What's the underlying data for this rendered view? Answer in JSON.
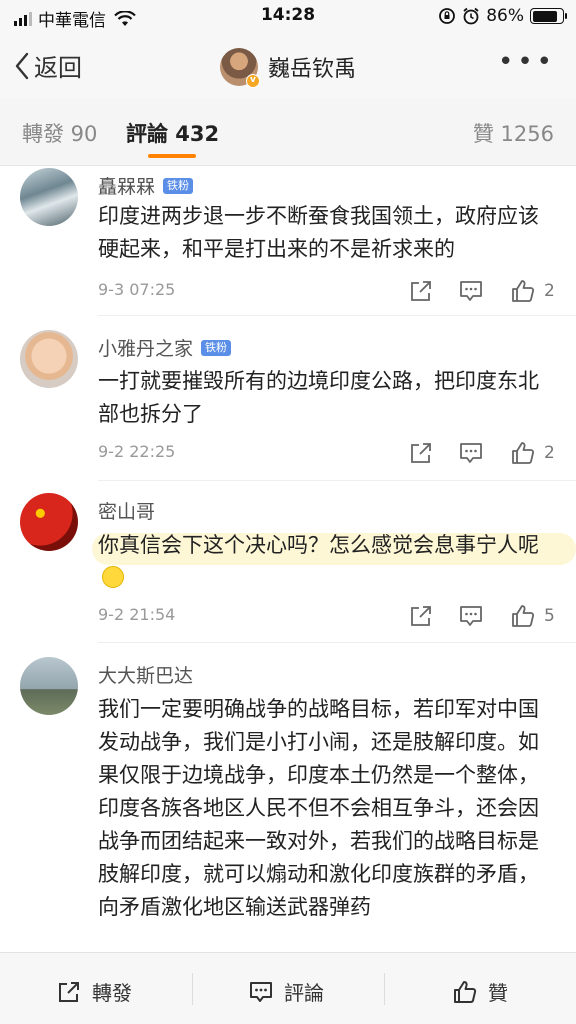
{
  "status_bar": {
    "carrier": "中華電信",
    "time": "14:28",
    "battery": "86%",
    "battery_level": 0.86
  },
  "nav": {
    "back_label": "返回",
    "title": "巍岳钦禹",
    "more": "•••"
  },
  "tabs": {
    "repost": "轉發 90",
    "comment": "評論 432",
    "like": "贊 1256"
  },
  "comments": [
    {
      "username": "矗槑槑",
      "badge": "铁粉",
      "text": "印度进两步退一步不断蚕食我国领土，政府应该硬起来，和平是打出来的不是祈求来的",
      "time": "9-3 07:25",
      "likes": "2"
    },
    {
      "username": "小雅丹之家",
      "badge": "铁粉",
      "text": "一打就要摧毁所有的边境印度公路，把印度东北部也拆分了",
      "time": "9-2 22:25",
      "likes": "2"
    },
    {
      "username": "密山哥",
      "badge": "",
      "text": "你真信会下这个决心吗？怎么感觉会息事宁人呢",
      "time": "9-2 21:54",
      "likes": "5"
    },
    {
      "username": "大大斯巴达",
      "badge": "",
      "text": "我们一定要明确战争的战略目标，若印军对中国发动战争，我们是小打小闹，还是肢解印度。如果仅限于边境战争，印度本土仍然是一个整体，印度各族各地区人民不但不会相互争斗，还会因战争而团结起来一致对外，若我们的战略目标是肢解印度，就可以煽动和激化印度族群的矛盾，向矛盾激化地区输送武器弹药",
      "time": "",
      "likes": ""
    }
  ],
  "bottom_bar": {
    "repost": "轉發",
    "comment": "評論",
    "like": "贊"
  },
  "colors": {
    "accent": "#ff8200",
    "badge": "#5b8ee6",
    "highlight": "#fdf7d6"
  }
}
